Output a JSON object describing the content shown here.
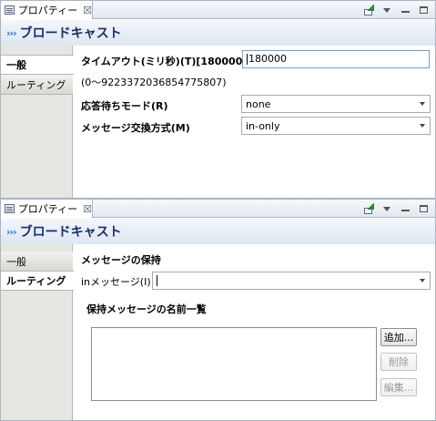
{
  "panel1": {
    "view_tab_title": "プロパティー",
    "view_tab_close": "☒",
    "title": "ブロードキャスト",
    "broadcast_icon": "›››",
    "tabs": [
      {
        "label": "一般",
        "selected": true
      },
      {
        "label": "ルーティング",
        "selected": false
      }
    ],
    "general": {
      "timeout_label": "タイムアウト(ミリ秒)(T)[180000]",
      "timeout_value": "180000",
      "timeout_range": "(0〜9223372036854775807)",
      "response_mode_label": "応答待ちモード(R)",
      "response_mode_value": "none",
      "exchange_pattern_label": "メッセージ交換方式(M)",
      "exchange_pattern_value": "in-only"
    }
  },
  "panel2": {
    "view_tab_title": "プロパティー",
    "view_tab_close": "☒",
    "title": "ブロードキャスト",
    "broadcast_icon": "›››",
    "tabs": [
      {
        "label": "一般",
        "selected": false
      },
      {
        "label": "ルーティング",
        "selected": true
      }
    ],
    "routing": {
      "section_title": "メッセージの保持",
      "in_message_label": "inメッセージ(I)",
      "in_message_value": "",
      "names_list_title": "保持メッセージの名前一覧",
      "add_button": "追加...",
      "delete_button": "削除",
      "edit_button": "編集..."
    }
  },
  "icons": {
    "view_icon": "properties-view-icon",
    "pin_icon": "pin-to-view-icon",
    "menu_icon": "view-menu-icon",
    "minimize_icon": "minimize-icon",
    "maximize_icon": "maximize-icon"
  }
}
